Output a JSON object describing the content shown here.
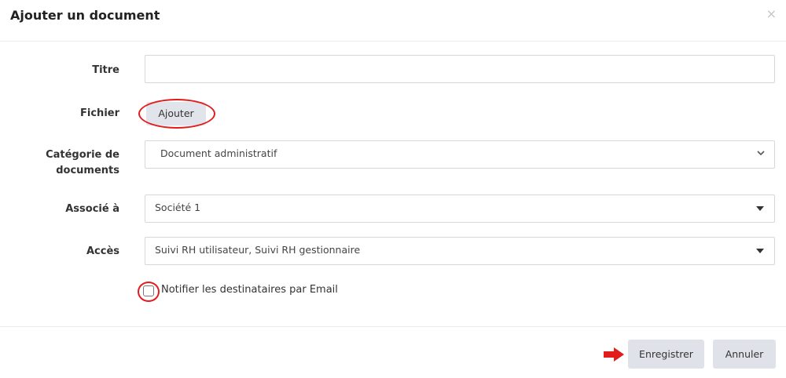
{
  "modal": {
    "title": "Ajouter un document",
    "close_glyph": "×"
  },
  "form": {
    "title_label": "Titre",
    "title_value": "",
    "file_label": "Fichier",
    "file_button": "Ajouter",
    "category_label_line1": "Catégorie de",
    "category_label_line2": "documents",
    "category_value": "Document administratif",
    "associated_label": "Associé à",
    "associated_value": "Société 1",
    "access_label": "Accès",
    "access_value": "Suivi RH utilisateur, Suivi RH gestionnaire",
    "notify_label": "Notifier les destinataires par Email",
    "notify_checked": false
  },
  "footer": {
    "save_label": "Enregistrer",
    "cancel_label": "Annuler"
  },
  "icons": {
    "close": "close-icon",
    "category_dropdown": "chevron-down-icon",
    "associated_dropdown": "caret-down-icon",
    "access_dropdown": "caret-down-icon",
    "annotation_arrow": "arrow-right-icon"
  },
  "colors": {
    "annotation": "#e21b1b",
    "button_bg": "#dfe3e9",
    "border": "#d7d7d7"
  }
}
